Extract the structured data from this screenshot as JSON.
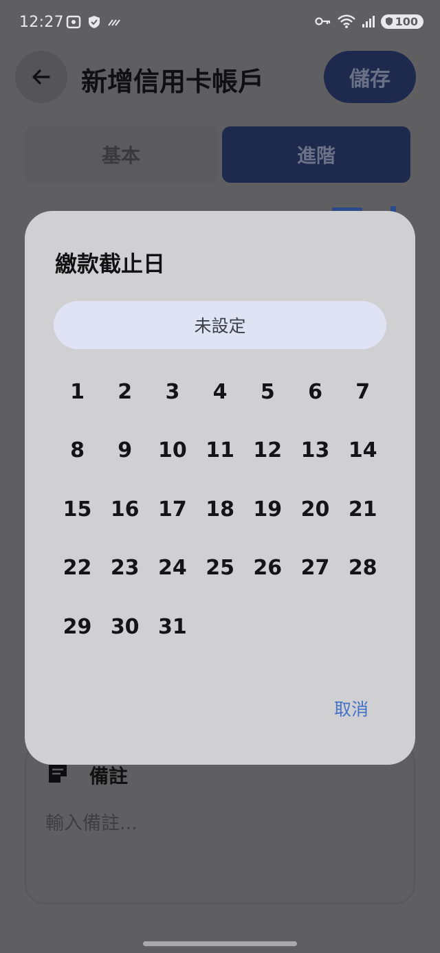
{
  "status_bar": {
    "time": "12:27",
    "battery": "100"
  },
  "app_bar": {
    "title": "新增信用卡帳戶",
    "save_label": "儲存"
  },
  "tabs": [
    {
      "label": "基本",
      "selected": false
    },
    {
      "label": "進階",
      "selected": true
    }
  ],
  "notes": {
    "title": "備註",
    "placeholder": "輸入備註..."
  },
  "dialog": {
    "title": "繳款截止日",
    "unset_label": "未設定",
    "days": [
      "1",
      "2",
      "3",
      "4",
      "5",
      "6",
      "7",
      "8",
      "9",
      "10",
      "11",
      "12",
      "13",
      "14",
      "15",
      "16",
      "17",
      "18",
      "19",
      "20",
      "21",
      "22",
      "23",
      "24",
      "25",
      "26",
      "27",
      "28",
      "29",
      "30",
      "31"
    ],
    "cancel_label": "取消"
  },
  "colors": {
    "accent": "#4671c9",
    "primary_dark": "#1d2a4d",
    "unset_bg": "#dfe3f4",
    "dialog_bg": "#d0d0d3"
  }
}
